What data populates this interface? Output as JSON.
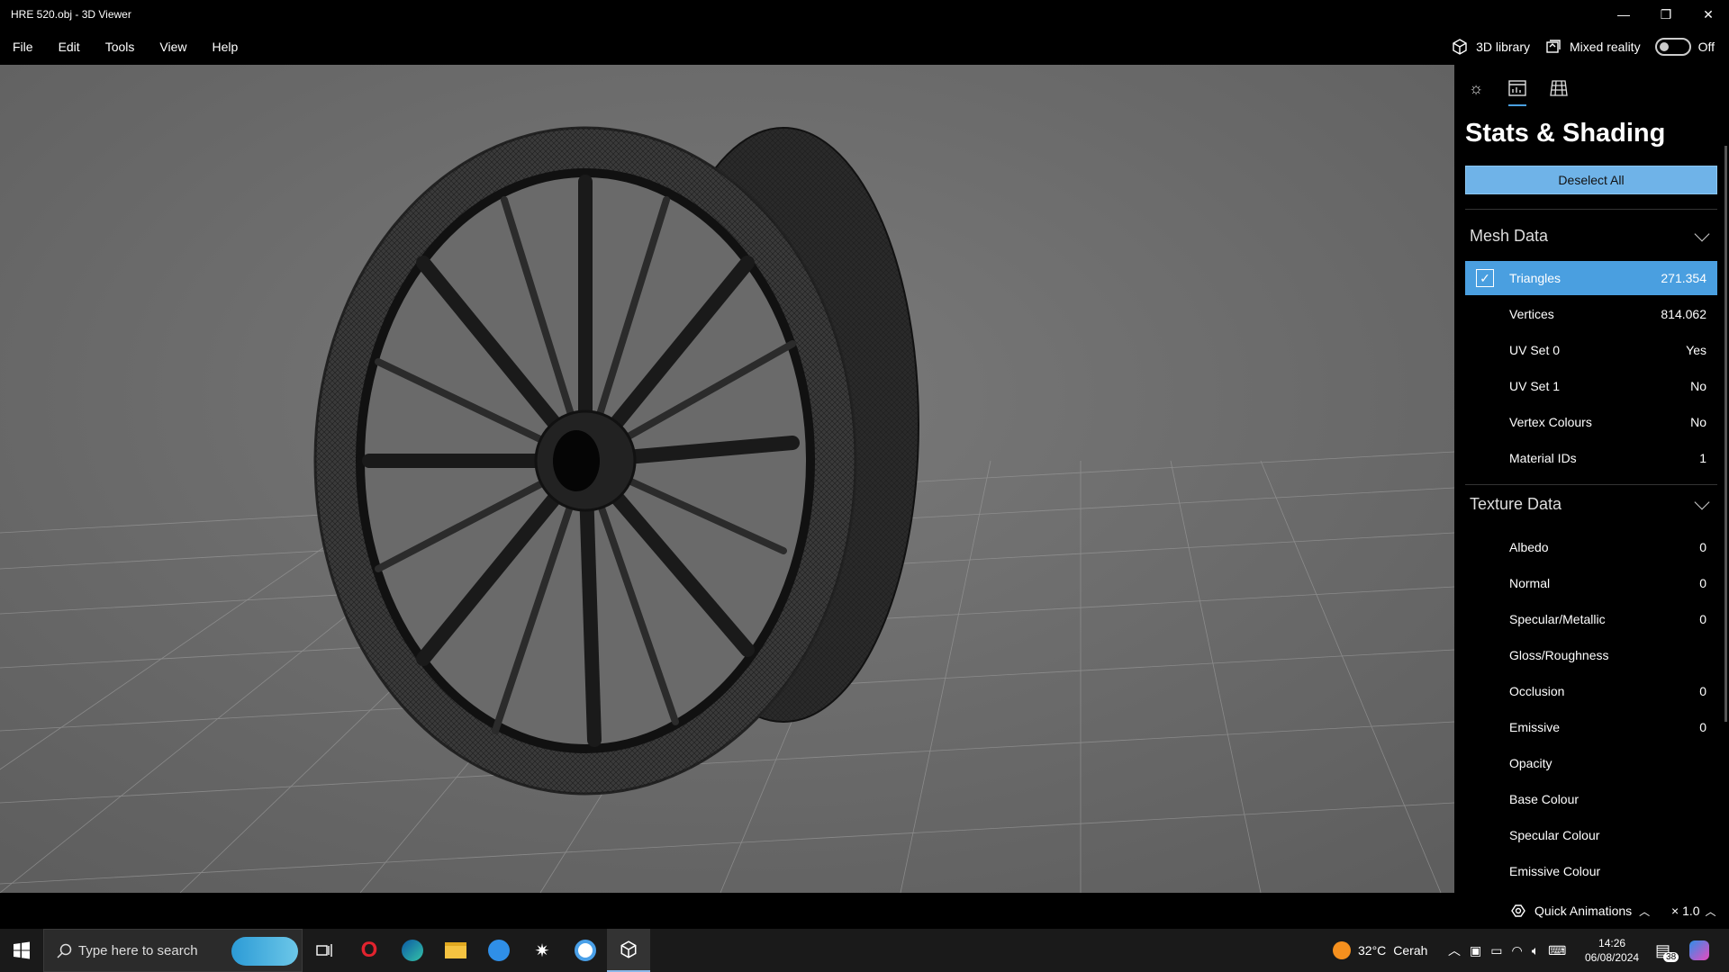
{
  "window": {
    "title": "HRE 520.obj - 3D Viewer",
    "minimize_glyph": "—",
    "restore_glyph": "❐",
    "close_glyph": "✕"
  },
  "menu": {
    "items": [
      "File",
      "Edit",
      "Tools",
      "View",
      "Help"
    ],
    "library_label": "3D library",
    "mixed_reality_label": "Mixed reality",
    "mixed_reality_state": "Off"
  },
  "panel": {
    "title": "Stats & Shading",
    "deselect_label": "Deselect All",
    "mesh_section": "Mesh Data",
    "mesh_rows": [
      {
        "label": "Triangles",
        "value": "271.354",
        "checked": true
      },
      {
        "label": "Vertices",
        "value": "814.062"
      },
      {
        "label": "UV Set 0",
        "value": "Yes"
      },
      {
        "label": "UV Set 1",
        "value": "No"
      },
      {
        "label": "Vertex Colours",
        "value": "No"
      },
      {
        "label": "Material IDs",
        "value": "1"
      }
    ],
    "texture_section": "Texture Data",
    "texture_rows": [
      {
        "label": "Albedo",
        "value": "0"
      },
      {
        "label": "Normal",
        "value": "0"
      },
      {
        "label": "Specular/Metallic",
        "value": "0"
      },
      {
        "label": "Gloss/Roughness",
        "value": ""
      },
      {
        "label": "Occlusion",
        "value": "0"
      },
      {
        "label": "Emissive",
        "value": "0"
      },
      {
        "label": "Opacity",
        "value": ""
      },
      {
        "label": "Base Colour",
        "value": ""
      },
      {
        "label": "Specular Colour",
        "value": ""
      },
      {
        "label": "Emissive Colour",
        "value": ""
      }
    ]
  },
  "animbar": {
    "quick_animations_label": "Quick Animations",
    "speed_label": "× 1.0"
  },
  "taskbar": {
    "search_placeholder": "Type here to search",
    "weather_temp": "32°C",
    "weather_desc": "Cerah",
    "time": "14:26",
    "date": "06/08/2024",
    "notification_count": "38"
  },
  "colors": {
    "accent": "#4a9fe0",
    "button_blue": "#6fb3e8",
    "viewport_bg": "#6a6a6a"
  }
}
